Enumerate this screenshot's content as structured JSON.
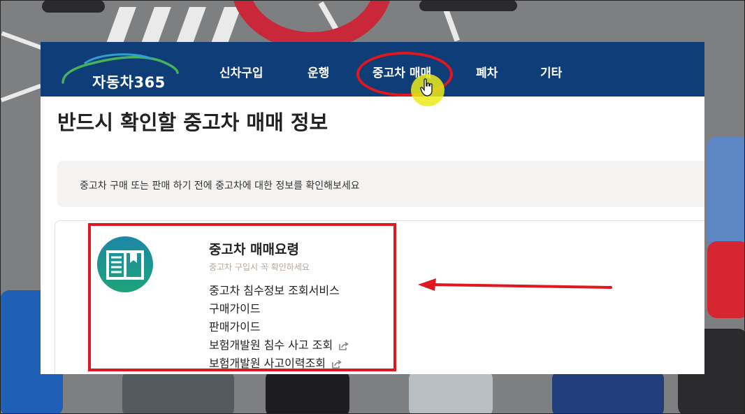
{
  "site": {
    "logo_text": "자동차365"
  },
  "nav": {
    "items": [
      {
        "label": "신차구입"
      },
      {
        "label": "운행"
      },
      {
        "label": "중고차 매매"
      },
      {
        "label": "폐차"
      },
      {
        "label": "기타"
      }
    ]
  },
  "page": {
    "title": "반드시 확인할 중고차 매매 정보",
    "notice": "중고차 구매 또는 판매 하기 전에 중고차에 대한 정보를 확인해보세요"
  },
  "card": {
    "icon": "book-icon",
    "title": "중고차 매매요령",
    "subtitle": "중고차 구입시 꼭 확인하세요",
    "links": [
      {
        "label": "중고차 침수정보 조회서비스",
        "external": false
      },
      {
        "label": "구매가이드",
        "external": false
      },
      {
        "label": "판매가이드",
        "external": false
      },
      {
        "label": "보험개발원 침수 사고 조회",
        "external": true
      },
      {
        "label": "보험개발원 사고이력조회",
        "external": true
      }
    ]
  },
  "colors": {
    "nav_bg": "#0e3d77",
    "highlight": "#e1171f",
    "cursor_highlight": "#ebeb19",
    "icon_teal": "#1a9a8a"
  },
  "annotations": {
    "ellipse_target": "nav-item-used-car",
    "arrow_target": "card-links",
    "cursor_icon": "hand-pointer-icon"
  }
}
